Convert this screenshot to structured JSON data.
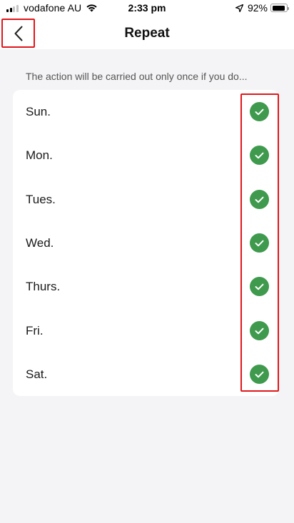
{
  "status_bar": {
    "carrier": "vodafone AU",
    "time": "2:33 pm",
    "battery": "92%",
    "battery_level": 0.92,
    "signal_bars": 2
  },
  "nav": {
    "title": "Repeat",
    "back_icon": "chevron-left-icon"
  },
  "description": "The action will be carried out only once if you do...",
  "days": [
    {
      "label": "Sun.",
      "checked": true
    },
    {
      "label": "Mon.",
      "checked": true
    },
    {
      "label": "Tues.",
      "checked": true
    },
    {
      "label": "Wed.",
      "checked": true
    },
    {
      "label": "Thurs.",
      "checked": true
    },
    {
      "label": "Fri.",
      "checked": true
    },
    {
      "label": "Sat.",
      "checked": true
    }
  ],
  "colors": {
    "check_green": "#3f9a4e",
    "highlight_red": "#e0161b",
    "background": "#f4f4f6"
  }
}
